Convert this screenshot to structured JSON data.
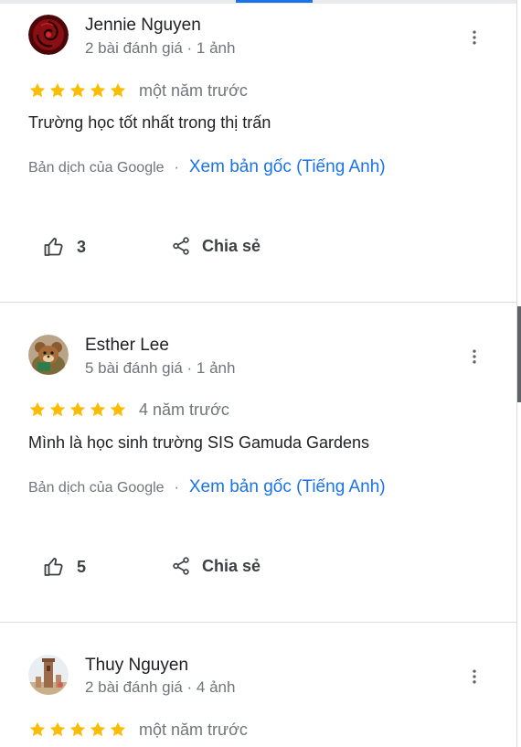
{
  "colors": {
    "star": "#fbbc04",
    "link": "#1a73e8",
    "secondary_text": "#70757a",
    "divider": "#dadce0"
  },
  "icons": {
    "more": "more-vert-icon",
    "like": "thumb-up-icon",
    "share": "share-icon",
    "star": "star-icon"
  },
  "reviews": [
    {
      "author": "Jennie Nguyen",
      "meta": "2 bài đánh giá · 1 ảnh",
      "rating": 5,
      "time": "một năm trước",
      "text": "Trường học tốt nhất trong thị trấn",
      "translated_by": "Bản dịch của Google",
      "separator": "·",
      "see_original": "Xem bản gốc (Tiếng Anh)",
      "likes": "3",
      "share_label": "Chia sẻ"
    },
    {
      "author": "Esther Lee",
      "meta": "5 bài đánh giá · 1 ảnh",
      "rating": 5,
      "time": "4 năm trước",
      "text": "Mình là học sinh trường SIS Gamuda Gardens",
      "translated_by": "Bản dịch của Google",
      "separator": "·",
      "see_original": "Xem bản gốc (Tiếng Anh)",
      "likes": "5",
      "share_label": "Chia sẻ"
    },
    {
      "author": "Thuy Nguyen",
      "meta": "2 bài đánh giá · 4 ảnh",
      "rating": 5,
      "time": "một năm trước"
    }
  ]
}
